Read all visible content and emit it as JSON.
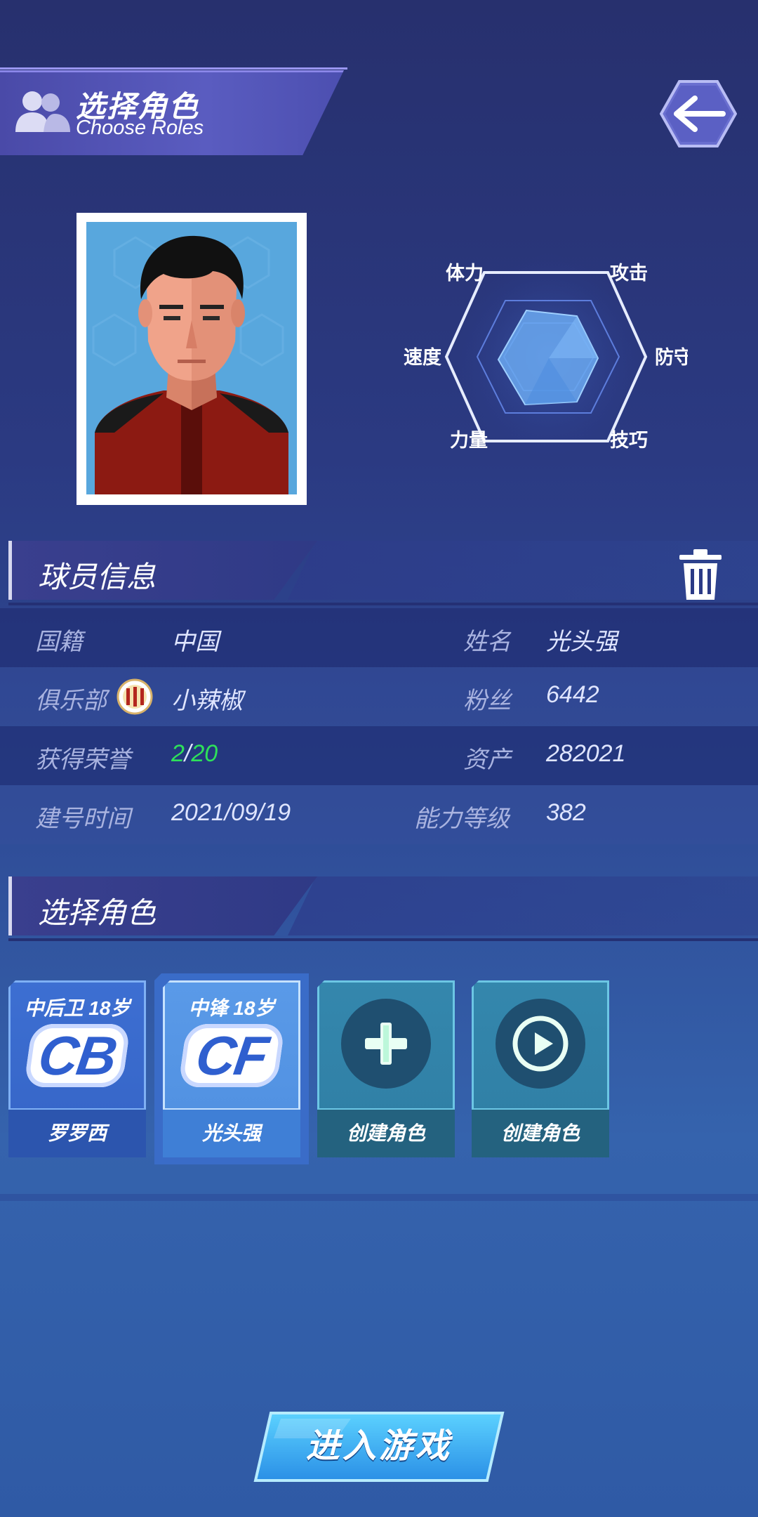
{
  "header": {
    "title": "选择角色",
    "subtitle": "Choose Roles",
    "back_icon": "arrow-left-icon"
  },
  "radar": {
    "labels": [
      "体力",
      "攻击",
      "防守",
      "技巧",
      "力量",
      "速度"
    ]
  },
  "player_info": {
    "section_title": "球员信息",
    "rows": [
      {
        "label_left": "国籍",
        "value_left": "中国",
        "label_right": "姓名",
        "value_right": "光头强"
      },
      {
        "label_left": "俱乐部",
        "value_left": "小辣椒",
        "label_right": "粉丝",
        "value_right": "6442"
      },
      {
        "label_left": "获得荣誉",
        "label_right": "资产",
        "value_right": "282021"
      },
      {
        "label_left": "建号时间",
        "value_left": "2021/09/19",
        "label_right": "能力等级",
        "value_right": "382"
      }
    ],
    "honors": {
      "current": "2",
      "separator": "/",
      "total": "20"
    }
  },
  "roles": {
    "section_title": "选择角色",
    "cards": [
      {
        "top": "中后卫 18岁",
        "code": "CB",
        "name": "罗罗西"
      },
      {
        "top": "中锋 18岁",
        "code": "CF",
        "name": "光头强"
      },
      {
        "name": "创建角色",
        "icon": "plus-icon"
      },
      {
        "name": "创建角色",
        "icon": "play-icon"
      }
    ]
  },
  "enter_button": {
    "label": "进入游戏"
  },
  "colors": {
    "accent_green": "#2ee05a",
    "card_selected": "#4f8fe0",
    "card_teal": "#2f8aa8"
  }
}
